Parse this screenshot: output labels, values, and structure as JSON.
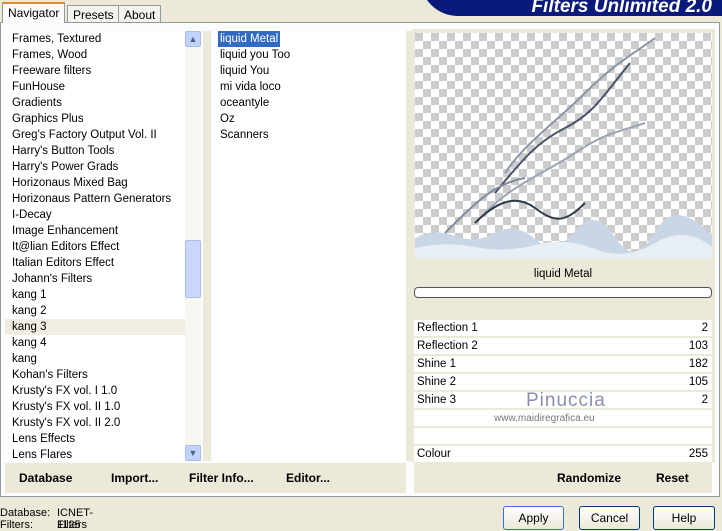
{
  "tabs": [
    {
      "label": "Navigator",
      "active": true
    },
    {
      "label": "Presets"
    },
    {
      "label": "About"
    }
  ],
  "logo": "Filters Unlimited 2.0",
  "categories": [
    "Frames, Textured",
    "Frames, Wood",
    "Freeware filters",
    "FunHouse",
    "Gradients",
    "Graphics Plus",
    "Greg's Factory Output Vol. II",
    "Harry's Button Tools",
    "Harry's Power Grads",
    "Horizonaus Mixed Bag",
    "Horizonaus Pattern Generators",
    "I-Decay",
    "Image Enhancement",
    "It@lian Editors Effect",
    "Italian Editors Effect",
    "Johann's Filters",
    "kang 1",
    "kang 2",
    "kang 3",
    "kang 4",
    "kang",
    "Kohan's Filters",
    "Krusty's FX vol. I 1.0",
    "Krusty's FX vol. II 1.0",
    "Krusty's FX vol. II 2.0",
    "Lens Effects",
    "Lens Flares"
  ],
  "selected_category": "kang 3",
  "filters": [
    "liquid Metal",
    "liquid you Too",
    "liquid You",
    "mi vida loco",
    "oceantyle",
    "Oz",
    "Scanners"
  ],
  "selected_filter": "liquid Metal",
  "preview": {
    "filter_name": "liquid Metal",
    "watermark": "Pinuccia",
    "watermark_url": "www.maidiregrafica.eu"
  },
  "params": [
    {
      "label": "Reflection 1",
      "value": 2
    },
    {
      "label": "Reflection 2",
      "value": 103
    },
    {
      "label": "Shine 1",
      "value": 182
    },
    {
      "label": "Shine 2",
      "value": 105
    },
    {
      "label": "Shine 3",
      "value": 2
    },
    {
      "label": "",
      "value": null
    },
    {
      "label": "",
      "value": null
    },
    {
      "label": "Colour",
      "value": 255
    }
  ],
  "param_max": 255,
  "bottom_left": {
    "database": "Database",
    "import": "Import...",
    "filter_info": "Filter Info...",
    "editor": "Editor..."
  },
  "bottom_right": {
    "randomize": "Randomize",
    "reset": "Reset"
  },
  "status": {
    "database_label": "Database:",
    "database_value": "ICNET-Filters",
    "filters_label": "Filters:",
    "filters_value": "1125"
  },
  "buttons": {
    "apply": "Apply",
    "cancel": "Cancel",
    "help": "Help"
  }
}
